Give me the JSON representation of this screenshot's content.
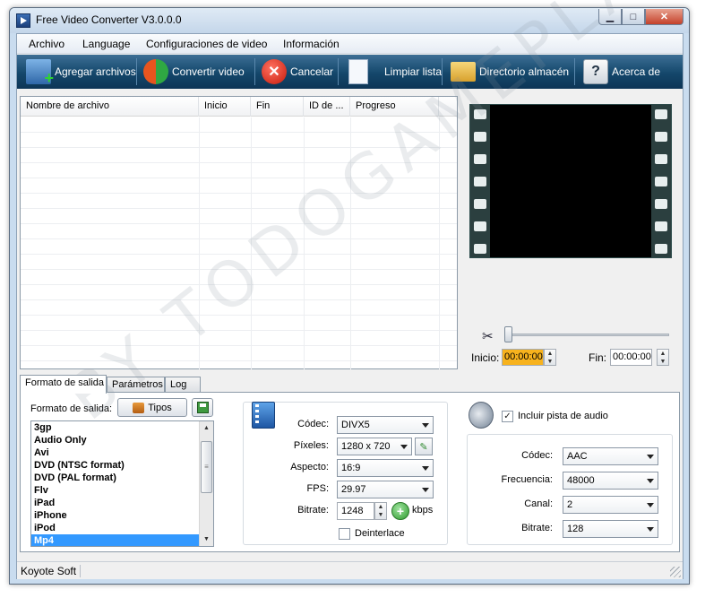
{
  "window": {
    "title": "Free Video Converter V3.0.0.0",
    "min_glyph": "▁",
    "max_glyph": "□",
    "close_glyph": "✕"
  },
  "menu": [
    "Archivo",
    "Language",
    "Configuraciones de video",
    "Información"
  ],
  "toolbar": {
    "add_files": "Agregar archivos",
    "convert_video": "Convertir video",
    "cancel": "Cancelar",
    "clear_list": "Limpiar lista",
    "storage_dir": "Directorio almacén",
    "about": "Acerca de"
  },
  "filelist": {
    "columns": [
      "Nombre de archivo",
      "Inicio",
      "Fin",
      "ID de ...",
      "Progreso"
    ]
  },
  "player": {
    "start_label": "Inicio:",
    "start_value": "00:00:00",
    "end_label": "Fin:",
    "end_value": "00:00:00"
  },
  "tabs": [
    "Formato de salida",
    "Parámetros",
    "Log"
  ],
  "output": {
    "label": "Formato de salida:",
    "tipos_label": "Tipos",
    "formats": [
      "3gp",
      "Audio Only",
      "Avi",
      "DVD (NTSC format)",
      "DVD (PAL format)",
      "Flv",
      "iPad",
      "iPhone",
      "iPod",
      "Mp4"
    ],
    "selected": "Mp4"
  },
  "video": {
    "codec_label": "Códec:",
    "codec_value": "DIVX5",
    "pixels_label": "Píxeles:",
    "pixels_value": "1280 x 720",
    "aspect_label": "Aspecto:",
    "aspect_value": "16:9",
    "fps_label": "FPS:",
    "fps_value": "29.97",
    "bitrate_label": "Bitrate:",
    "bitrate_value": "1248",
    "bitrate_unit": "kbps",
    "deinterlace_label": "Deinterlace",
    "deinterlace_checked": false
  },
  "audio": {
    "include_label": "Incluir pista de audio",
    "include_checked": true,
    "codec_label": "Códec:",
    "codec_value": "AAC",
    "frequency_label": "Frecuencia:",
    "frequency_value": "48000",
    "channel_label": "Canal:",
    "channel_value": "2",
    "bitrate_label": "Bitrate:",
    "bitrate_value": "128"
  },
  "status": {
    "text": "Koyote Soft"
  },
  "watermark": "BY TODOGAMEPLAY"
}
